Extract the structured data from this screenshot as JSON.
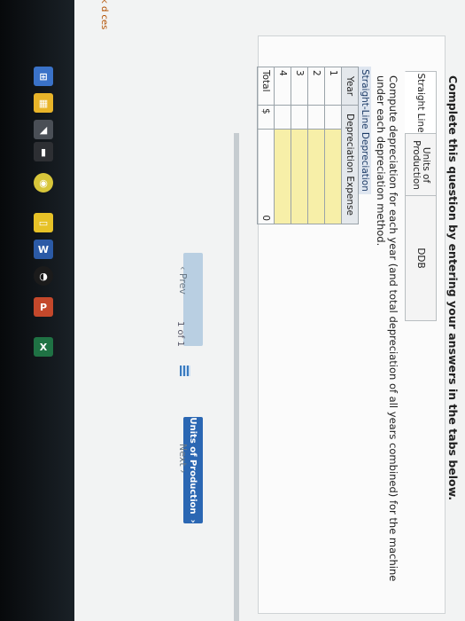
{
  "instruction": "Complete this question by entering your answers in the tabs below.",
  "tabs": [
    {
      "label": "Straight Line",
      "active": true
    },
    {
      "label": "Units of Production",
      "active": false
    },
    {
      "label": "DDB",
      "active": false
    }
  ],
  "prompt": "Compute depreciation for each year (and total depreciation of all years combined) for the machine under each depreciation method.",
  "table": {
    "title": "Straight-Line Depreciation",
    "headers": {
      "year": "Year",
      "expense": "Depreciation Expense"
    },
    "rows": [
      "1",
      "2",
      "3",
      "4"
    ],
    "total_label": "Total",
    "total_currency": "$",
    "total_value": "0"
  },
  "nav": {
    "prev": "Prev",
    "page": "1 of 1",
    "next": "Next",
    "next_tab_button": "Units of Production"
  },
  "side": {
    "left_partial_labels": [
      "k",
      "d",
      "ces"
    ]
  },
  "colors": {
    "input_yellow": "#f7efa8",
    "button_blue": "#2b67b3",
    "link_gray": "#6a7885"
  }
}
